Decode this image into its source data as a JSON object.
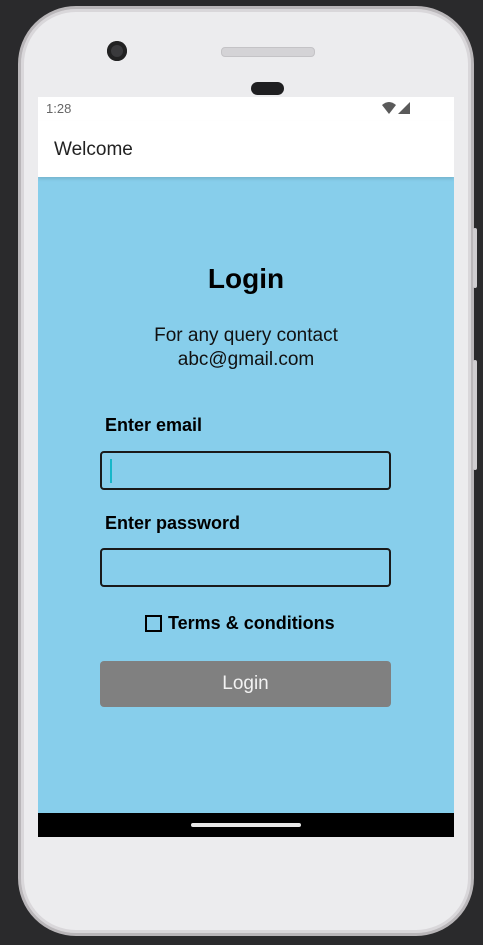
{
  "status_bar": {
    "time": "1:28",
    "icons": [
      "wifi-icon",
      "signal-icon"
    ]
  },
  "app_bar": {
    "title": "Welcome"
  },
  "login": {
    "title": "Login",
    "contact_line1": "For any query contact",
    "contact_line2": "abc@gmail.com",
    "email_label": "Enter email",
    "email_value": "",
    "password_label": "Enter password",
    "password_value": "",
    "terms_label": "Terms & conditions",
    "terms_checked": false,
    "button_label": "Login"
  },
  "colors": {
    "background": "#87ceeb",
    "button": "#808080",
    "caret": "#17b7c9"
  }
}
